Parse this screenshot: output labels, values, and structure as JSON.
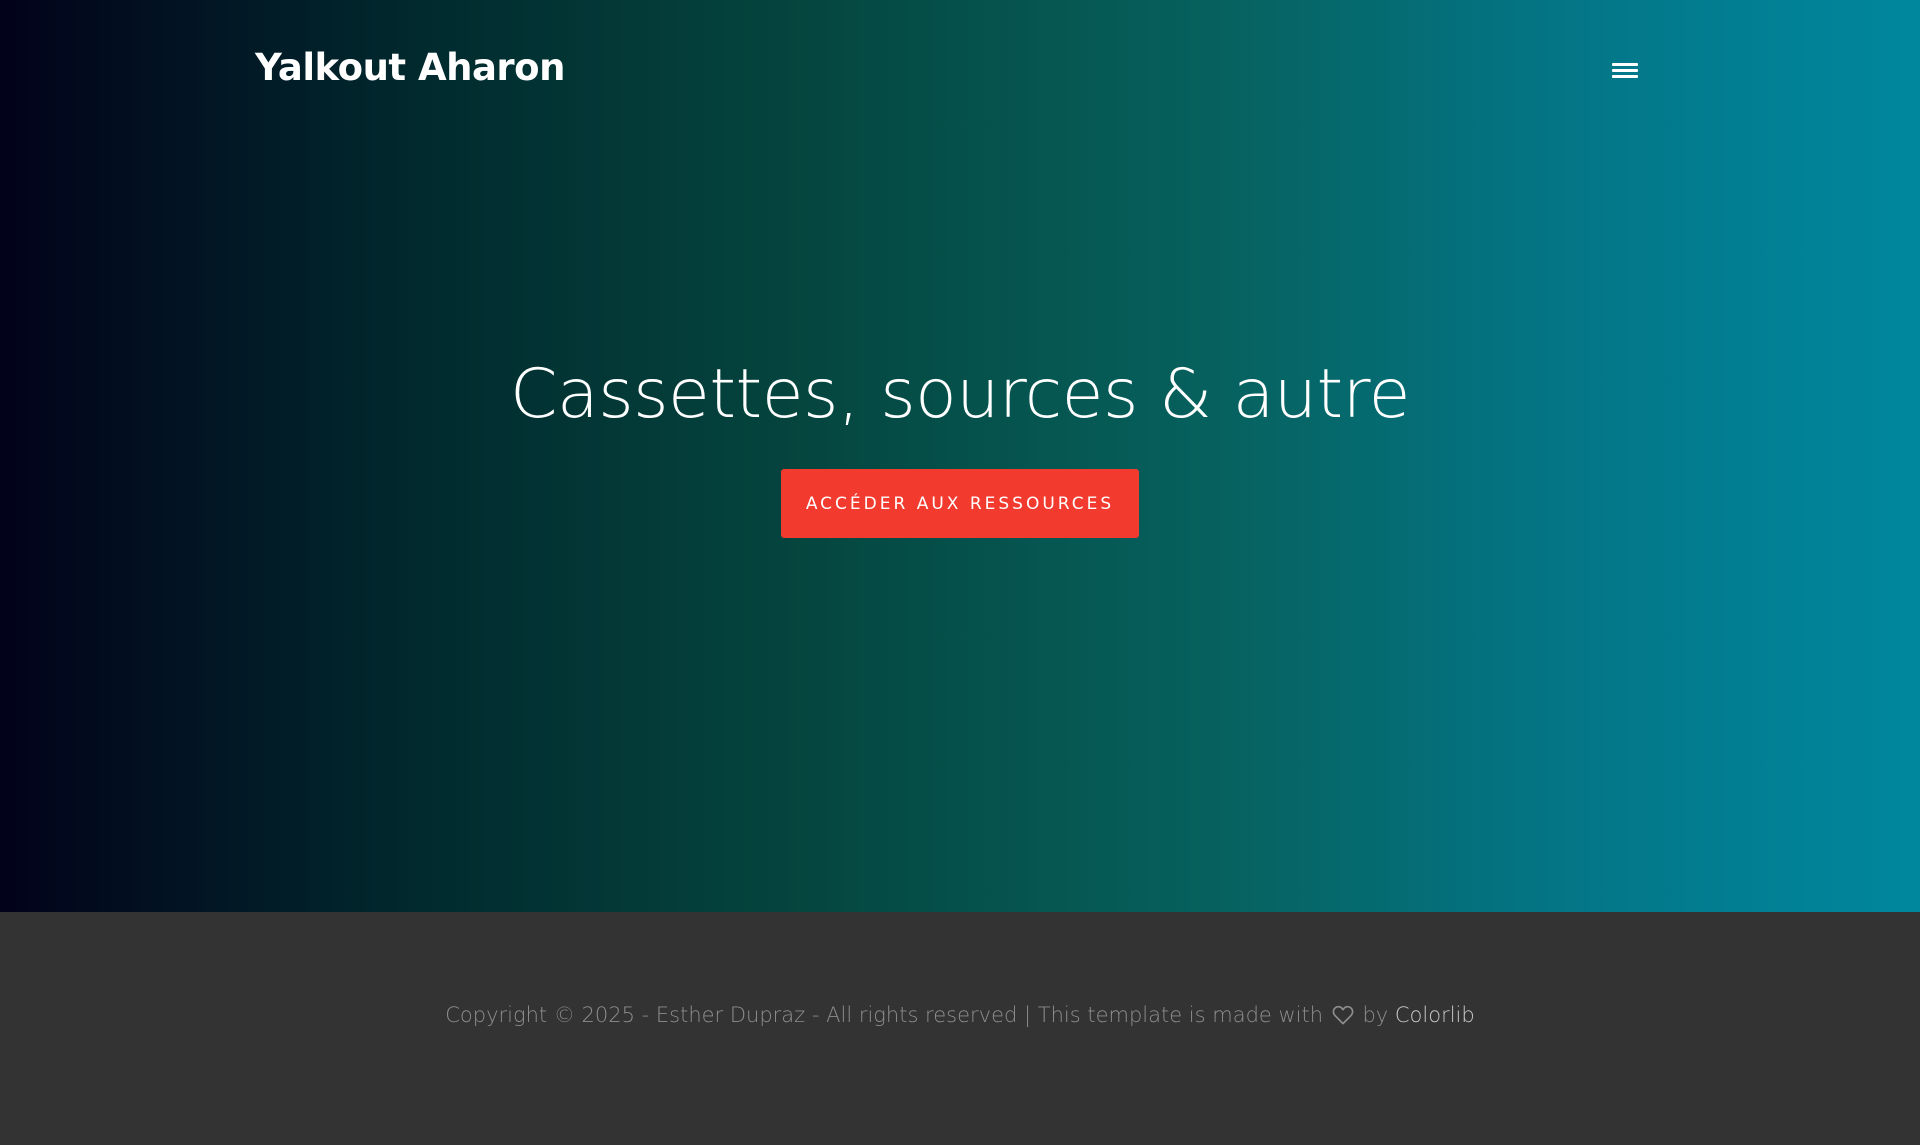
{
  "header": {
    "brand": "Yalkout Aharon",
    "menu_icon": "hamburger-menu-icon"
  },
  "hero": {
    "title": "Cassettes, sources & autre",
    "cta_label": "ACCÉDER AUX RESSOURCES",
    "cta_color": "#f23a2f",
    "gradient_colors": [
      "#02021a",
      "#012a2e",
      "#05463f",
      "#06625f",
      "#047484",
      "#00879e"
    ]
  },
  "footer": {
    "copyright_text": "Copyright © 2025 - Esther Dupraz - All rights reserved | This template is made with",
    "heart_icon": "heart-outline-icon",
    "by_text": "by",
    "credit_link": "Colorlib",
    "background_color": "#333333"
  }
}
